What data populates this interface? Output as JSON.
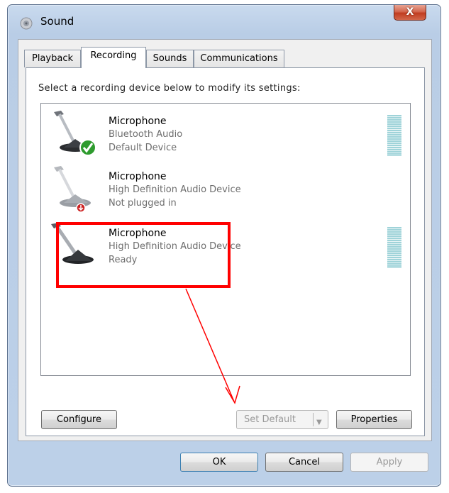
{
  "window": {
    "title": "Sound",
    "close_label": "X"
  },
  "tabs": [
    {
      "label": "Playback",
      "active": false
    },
    {
      "label": "Recording",
      "active": true
    },
    {
      "label": "Sounds",
      "active": false
    },
    {
      "label": "Communications",
      "active": false
    }
  ],
  "instruction": "Select a recording device below to modify its settings:",
  "devices": [
    {
      "name": "Microphone",
      "line2": "Bluetooth Audio",
      "line3": "Default Device",
      "status_icon": "checkmark-icon",
      "has_level_meter": true
    },
    {
      "name": "Microphone",
      "line2": "High Definition Audio Device",
      "line3": "Not plugged in",
      "status_icon": "unplugged-icon",
      "has_level_meter": false
    },
    {
      "name": "Microphone",
      "line2": "High Definition Audio Device",
      "line3": "Ready",
      "status_icon": "",
      "has_level_meter": true
    }
  ],
  "buttons": {
    "configure": "Configure",
    "set_default": "Set Default",
    "properties": "Properties",
    "ok": "OK",
    "cancel": "Cancel",
    "apply": "Apply"
  },
  "colors": {
    "annotation": "#ff0000",
    "check_green": "#2e9b2e",
    "unplugged_red": "#cc2020",
    "level_meter": "#9fd3d9"
  }
}
